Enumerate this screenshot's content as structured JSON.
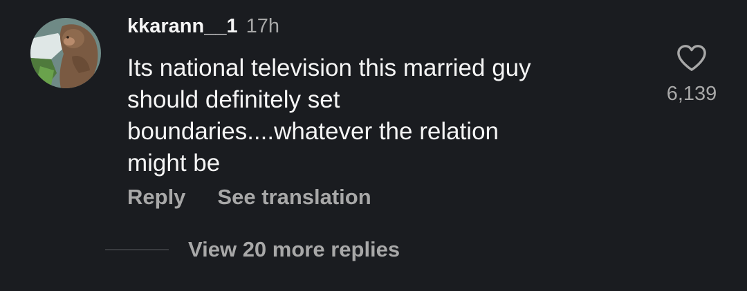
{
  "comment": {
    "username": "kkarann__1",
    "timestamp": "17h",
    "text_lines": [
      "Its national television this married guy",
      "should definitely set",
      "boundaries....whatever the relation",
      "might be"
    ],
    "like_count": "6,139",
    "like_icon": "heart-outline-icon"
  },
  "actions": {
    "reply_label": "Reply",
    "translate_label": "See translation"
  },
  "replies": {
    "view_more_label": "View 20 more replies"
  },
  "colors": {
    "background": "#1a1c20",
    "primary_text": "#f5f5f5",
    "secondary_text": "#a8a8a8",
    "divider": "#3a3c40"
  }
}
